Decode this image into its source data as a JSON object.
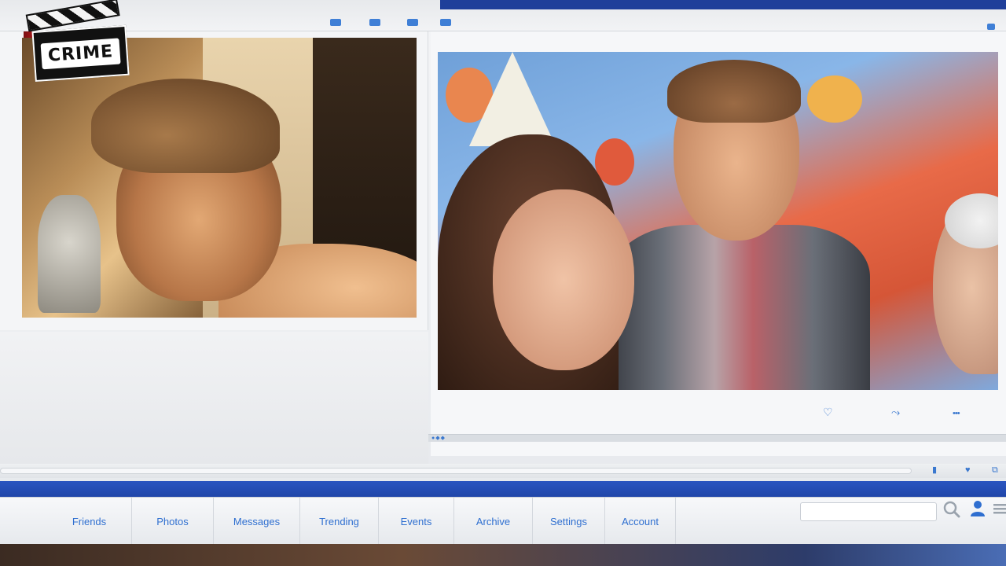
{
  "logo": {
    "text": "CRIME"
  },
  "nav": {
    "items": [
      {
        "label": "Friends"
      },
      {
        "label": "Photos"
      },
      {
        "label": "Messages"
      },
      {
        "label": "Trending"
      },
      {
        "label": "Events"
      },
      {
        "label": "Archive"
      },
      {
        "label": "Settings"
      },
      {
        "label": "Account"
      }
    ],
    "search_placeholder": ""
  },
  "post_actions": {
    "like": "♡",
    "share": "⤳",
    "more": "•••"
  },
  "icons": {
    "search": "search-icon",
    "user": "user-icon",
    "menu": "menu-icon",
    "heart": "heart-icon",
    "share": "share-icon",
    "more": "more-icon"
  },
  "colors": {
    "accent": "#2f6fd0",
    "nav_band": "#1b3f9e",
    "logo_bg": "#111111"
  }
}
